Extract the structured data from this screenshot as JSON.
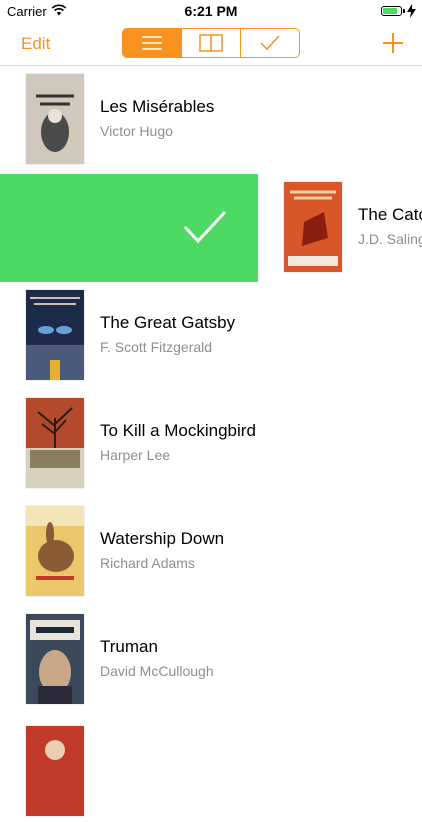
{
  "status_bar": {
    "carrier": "Carrier",
    "time": "6:21 PM"
  },
  "nav": {
    "edit_label": "Edit",
    "segments": [
      "list-icon",
      "columns-icon",
      "checkmark-icon"
    ],
    "selected_segment": 0
  },
  "colors": {
    "accent": "#f7931e",
    "swipe_action": "#4cd964",
    "subtitle": "#8e8e93"
  },
  "swipe_action_icon": "checkmark-icon",
  "books": [
    {
      "title": "Les Misérables",
      "author": "Victor Hugo"
    },
    {
      "title": "The Catcher in the Rye",
      "author": "J.D. Salinger"
    },
    {
      "title": "The Great Gatsby",
      "author": "F. Scott Fitzgerald"
    },
    {
      "title": "To Kill a Mockingbird",
      "author": "Harper Lee"
    },
    {
      "title": "Watership Down",
      "author": "Richard Adams"
    },
    {
      "title": "Truman",
      "author": "David McCullough"
    }
  ]
}
